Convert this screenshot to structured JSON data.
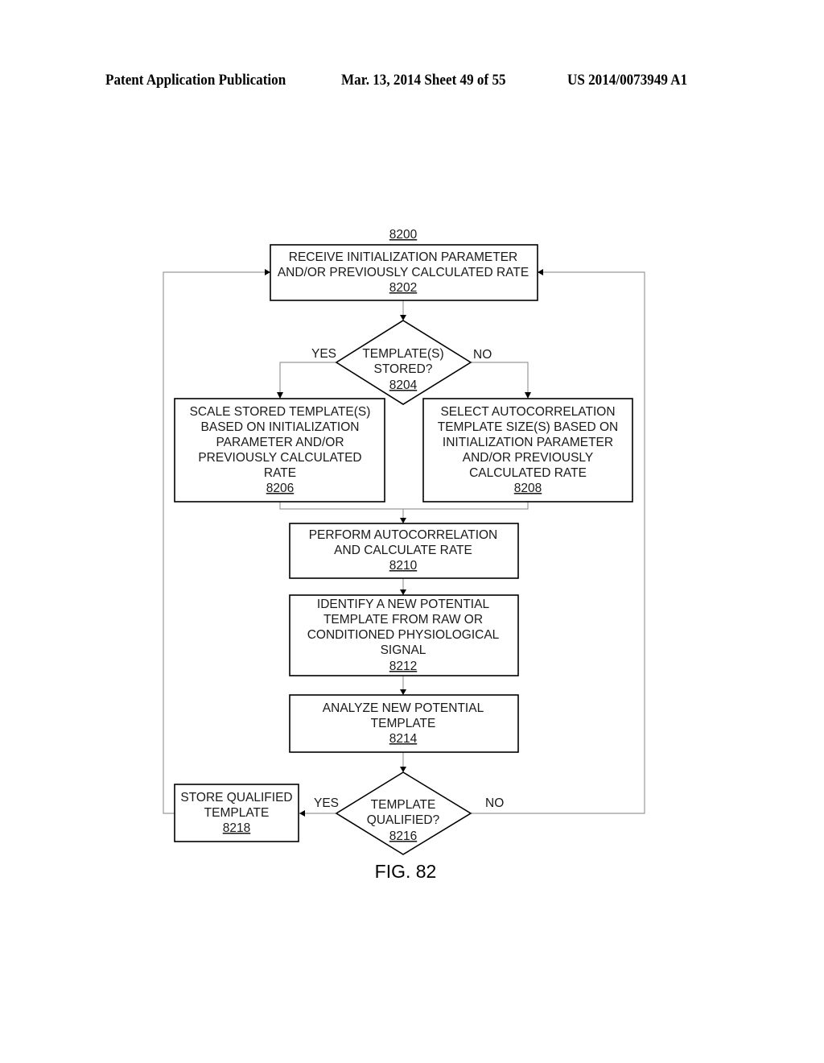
{
  "header": {
    "publication": "Patent Application Publication",
    "date_sheet": "Mar. 13, 2014  Sheet 49 of 55",
    "number": "US 2014/0073949 A1"
  },
  "diagram": {
    "ref": "8200",
    "figure_label": "FIG. 82",
    "nodes": {
      "n8202": {
        "lines": [
          "RECEIVE INITIALIZATION PARAMETER",
          "AND/OR PREVIOUSLY CALCULATED RATE"
        ],
        "ref": "8202"
      },
      "n8204": {
        "lines": [
          "TEMPLATE(S)",
          "STORED?"
        ],
        "ref": "8204"
      },
      "n8206": {
        "lines": [
          "SCALE STORED TEMPLATE(S)",
          "BASED ON INITIALIZATION",
          "PARAMETER AND/OR",
          "PREVIOUSLY CALCULATED",
          "RATE"
        ],
        "ref": "8206"
      },
      "n8208": {
        "lines": [
          "SELECT AUTOCORRELATION",
          "TEMPLATE SIZE(S) BASED ON",
          "INITIALIZATION PARAMETER",
          "AND/OR PREVIOUSLY",
          "CALCULATED RATE"
        ],
        "ref": "8208"
      },
      "n8210": {
        "lines": [
          "PERFORM AUTOCORRELATION",
          "AND CALCULATE RATE"
        ],
        "ref": "8210"
      },
      "n8212": {
        "lines": [
          "IDENTIFY A NEW POTENTIAL",
          "TEMPLATE FROM RAW OR",
          "CONDITIONED PHYSIOLOGICAL",
          "SIGNAL"
        ],
        "ref": "8212"
      },
      "n8214": {
        "lines": [
          "ANALYZE NEW POTENTIAL",
          "TEMPLATE"
        ],
        "ref": "8214"
      },
      "n8216": {
        "lines": [
          "TEMPLATE",
          "QUALIFIED?"
        ],
        "ref": "8216"
      },
      "n8218": {
        "lines": [
          "STORE QUALIFIED",
          "TEMPLATE"
        ],
        "ref": "8218"
      }
    },
    "edge_labels": {
      "d8204_yes": "YES",
      "d8204_no": "NO",
      "d8216_yes": "YES",
      "d8216_no": "NO"
    }
  }
}
